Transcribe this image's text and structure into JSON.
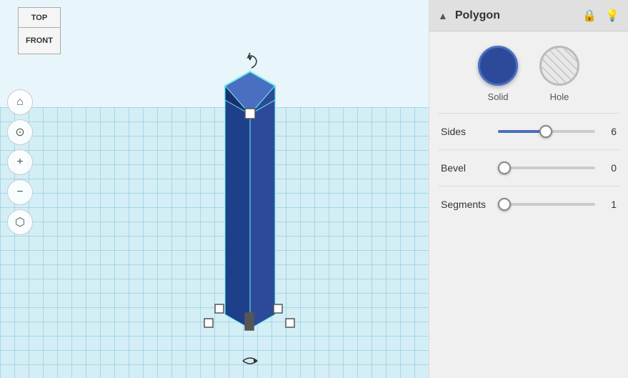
{
  "viewport": {
    "background_color": "#dff0f5"
  },
  "view_cube": {
    "top_label": "TOP",
    "front_label": "FRONT"
  },
  "nav_buttons": [
    {
      "icon": "⌂",
      "name": "home-icon"
    },
    {
      "icon": "⊙",
      "name": "fit-icon"
    },
    {
      "icon": "+",
      "name": "zoom-in-icon"
    },
    {
      "icon": "−",
      "name": "zoom-out-icon"
    },
    {
      "icon": "⬡",
      "name": "view-mode-icon"
    }
  ],
  "panel": {
    "title": "Polygon",
    "lock_icon": "🔒",
    "bulb_icon": "💡",
    "collapse_arrow": "▲",
    "shape_types": [
      {
        "label": "Solid",
        "type": "solid"
      },
      {
        "label": "Hole",
        "type": "hole"
      }
    ],
    "params": [
      {
        "label": "Sides",
        "value": "6",
        "fill_pct": 55
      },
      {
        "label": "Bevel",
        "value": "0",
        "fill_pct": 0
      },
      {
        "label": "Segments",
        "value": "1",
        "fill_pct": 0
      }
    ]
  },
  "shape": {
    "color": "#2d4a9a",
    "accent_color": "#1a3070"
  }
}
